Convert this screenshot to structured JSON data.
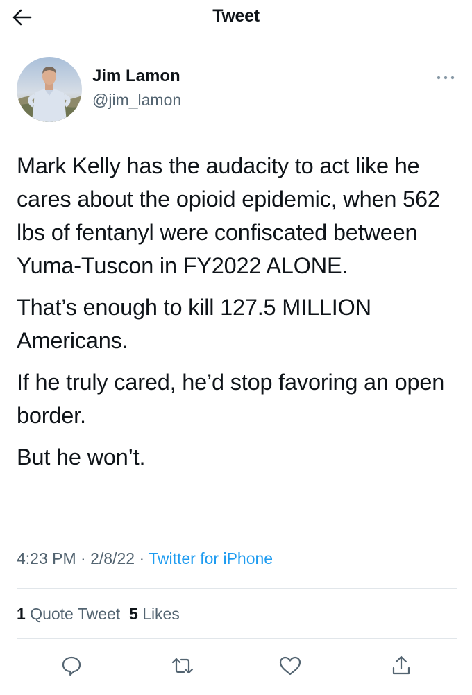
{
  "header": {
    "title": "Tweet",
    "back_icon": "arrow-left-icon"
  },
  "author": {
    "name": "Jim Lamon",
    "handle": "@jim_lamon"
  },
  "tweet": {
    "paragraphs": [
      "Mark Kelly has the audacity to act like he cares about the opioid epidemic, when 562 lbs of fentanyl were confiscated between Yuma-Tuscon in FY2022 ALONE.",
      "That’s enough to kill 127.5 MILLION Americans.",
      "If he truly cared, he’d stop favoring an open border.",
      "But he won’t."
    ],
    "time": "4:23 PM",
    "separator": "·",
    "date": "2/8/22",
    "source": "Twitter for iPhone"
  },
  "stats": {
    "quote_count": "1",
    "quote_label": "Quote Tweet",
    "like_count": "5",
    "like_label": "Likes"
  },
  "actions": [
    "reply-icon",
    "retweet-icon",
    "like-icon",
    "share-icon"
  ],
  "colors": {
    "link": "#1d9bf0",
    "secondary_text": "#536471",
    "divider": "#e1e6ea"
  }
}
